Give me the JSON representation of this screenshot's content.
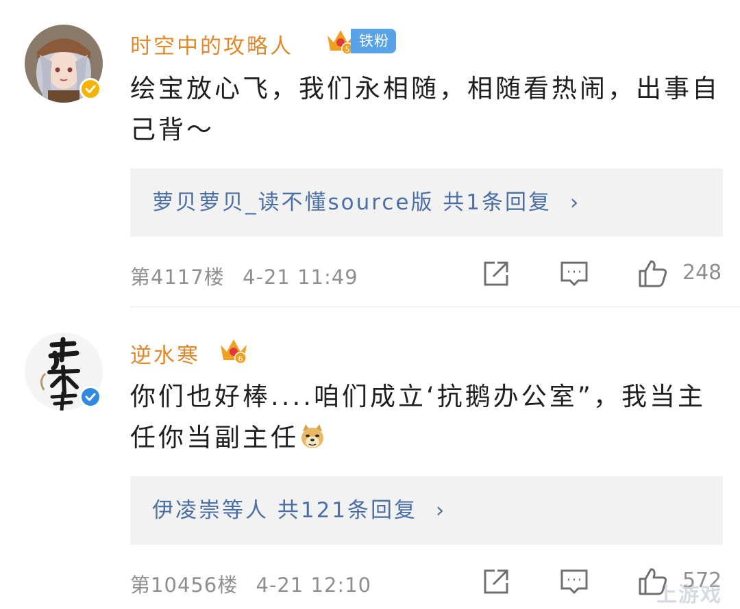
{
  "comments": [
    {
      "username": "时空中的攻略人",
      "username_color": "#e0892c",
      "level": "5",
      "fan_badge": "铁粉",
      "fan_badge_color": "#58a3e8",
      "verify_color": "#f5b400",
      "text": "绘宝放心飞，我们永相随，相随看热闹，出事自己背～",
      "reply_summary": "萝贝萝贝_读不懂source版  共1条回复",
      "reply_chevron": "›",
      "floor": "第4117楼",
      "timestamp": "4-21 11:49",
      "like_count": "248",
      "avatar_icon": "anime-girl-avatar",
      "actions": [
        "share-icon",
        "comment-icon",
        "like-icon"
      ]
    },
    {
      "username": "逆水寒",
      "username_color": "#e0892c",
      "level": "6",
      "verify_color": "#2f8ae0",
      "text_before_emoji": "你们也好棒....咱们成立‘抗鹅办公室”，我当主任你当副主任",
      "emoji": "doge-emoji",
      "reply_summary": "伊凌崇等人  共121条回复",
      "reply_chevron": "›",
      "floor": "第10456楼",
      "timestamp": "4-21 12:10",
      "like_count": "572",
      "avatar_icon": "calligraphy-logo-avatar",
      "actions": [
        "share-icon",
        "comment-icon",
        "like-icon"
      ]
    }
  ],
  "watermark": "上游戏"
}
